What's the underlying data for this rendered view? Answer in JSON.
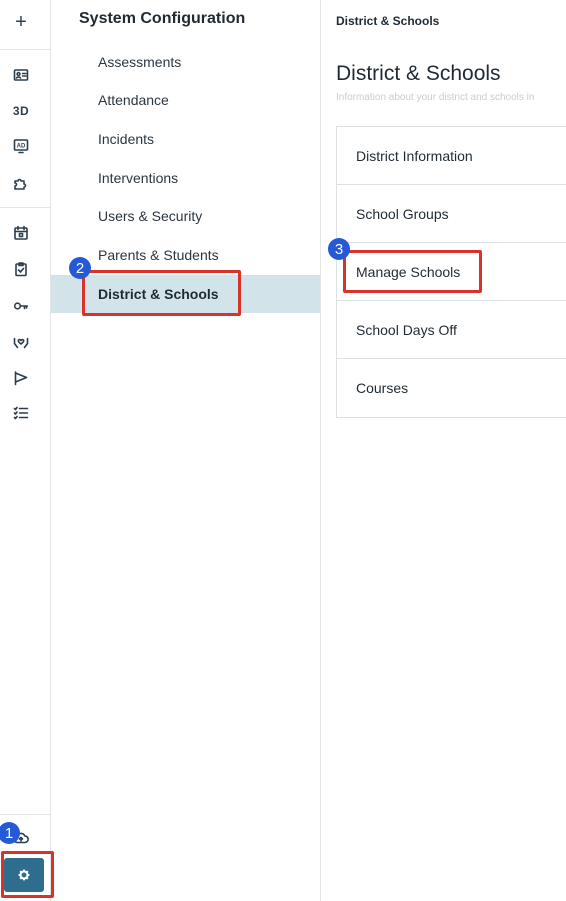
{
  "rail": {
    "items": [
      {
        "icon": "plus-icon",
        "glyph": "+"
      },
      {
        "icon": "id-card-icon"
      },
      {
        "icon": "3d-icon",
        "label": "3D"
      },
      {
        "icon": "ad-monitor-icon",
        "label": "AD"
      },
      {
        "icon": "puzzle-icon"
      },
      {
        "icon": "calendar-icon"
      },
      {
        "icon": "clipboard-check-icon"
      },
      {
        "icon": "key-icon"
      },
      {
        "icon": "hands-heart-icon"
      },
      {
        "icon": "flag-icon"
      },
      {
        "icon": "checklist-icon"
      },
      {
        "icon": "cloud-upload-icon"
      },
      {
        "icon": "gear-icon"
      }
    ]
  },
  "sidebar": {
    "title": "System Configuration",
    "items": [
      {
        "label": "Assessments"
      },
      {
        "label": "Attendance"
      },
      {
        "label": "Incidents"
      },
      {
        "label": "Interventions"
      },
      {
        "label": "Users & Security"
      },
      {
        "label": "Parents & Students"
      },
      {
        "label": "District & Schools",
        "active": true
      }
    ]
  },
  "main": {
    "breadcrumb": "District & Schools",
    "title": "District & Schools",
    "subtitle": "Information about your district and schools in",
    "rows": [
      {
        "label": "District Information"
      },
      {
        "label": "School Groups"
      },
      {
        "label": "Manage Schools"
      },
      {
        "label": "School Days Off"
      },
      {
        "label": "Courses"
      }
    ]
  },
  "annotations": {
    "badges": [
      "1",
      "2",
      "3"
    ],
    "highlight_color": "#d8322b",
    "badge_color": "#2559d6"
  },
  "colors": {
    "accent": "#2f6d8e",
    "active_bg": "#d3e3ea"
  }
}
